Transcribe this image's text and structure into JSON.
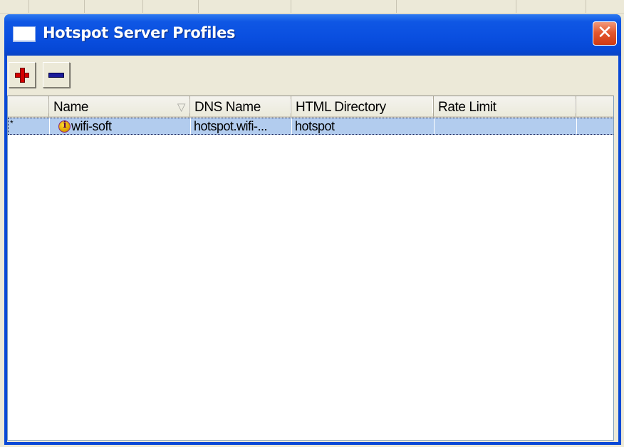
{
  "window": {
    "title": "Hotspot Server Profiles",
    "close_glyph": "✕"
  },
  "toolbar": {
    "add_icon": "plus-icon",
    "remove_icon": "minus-icon"
  },
  "table": {
    "columns": [
      {
        "label": ""
      },
      {
        "label": "Name"
      },
      {
        "label": "DNS Name"
      },
      {
        "label": "HTML Directory"
      },
      {
        "label": "Rate Limit"
      },
      {
        "label": ""
      }
    ],
    "sort_indicator": "▽",
    "rows": [
      {
        "flag": "*",
        "icon": "info-icon",
        "name": "wifi-soft",
        "dns_name": "hotspot.wifi-...",
        "html_directory": "hotspot",
        "rate_limit": ""
      }
    ]
  },
  "colors": {
    "titlebar": "#0a4fe0",
    "close_button": "#e4582f",
    "selected_row": "#b2ccee",
    "add_icon": "#d40000",
    "remove_icon": "#1a1a9a"
  }
}
